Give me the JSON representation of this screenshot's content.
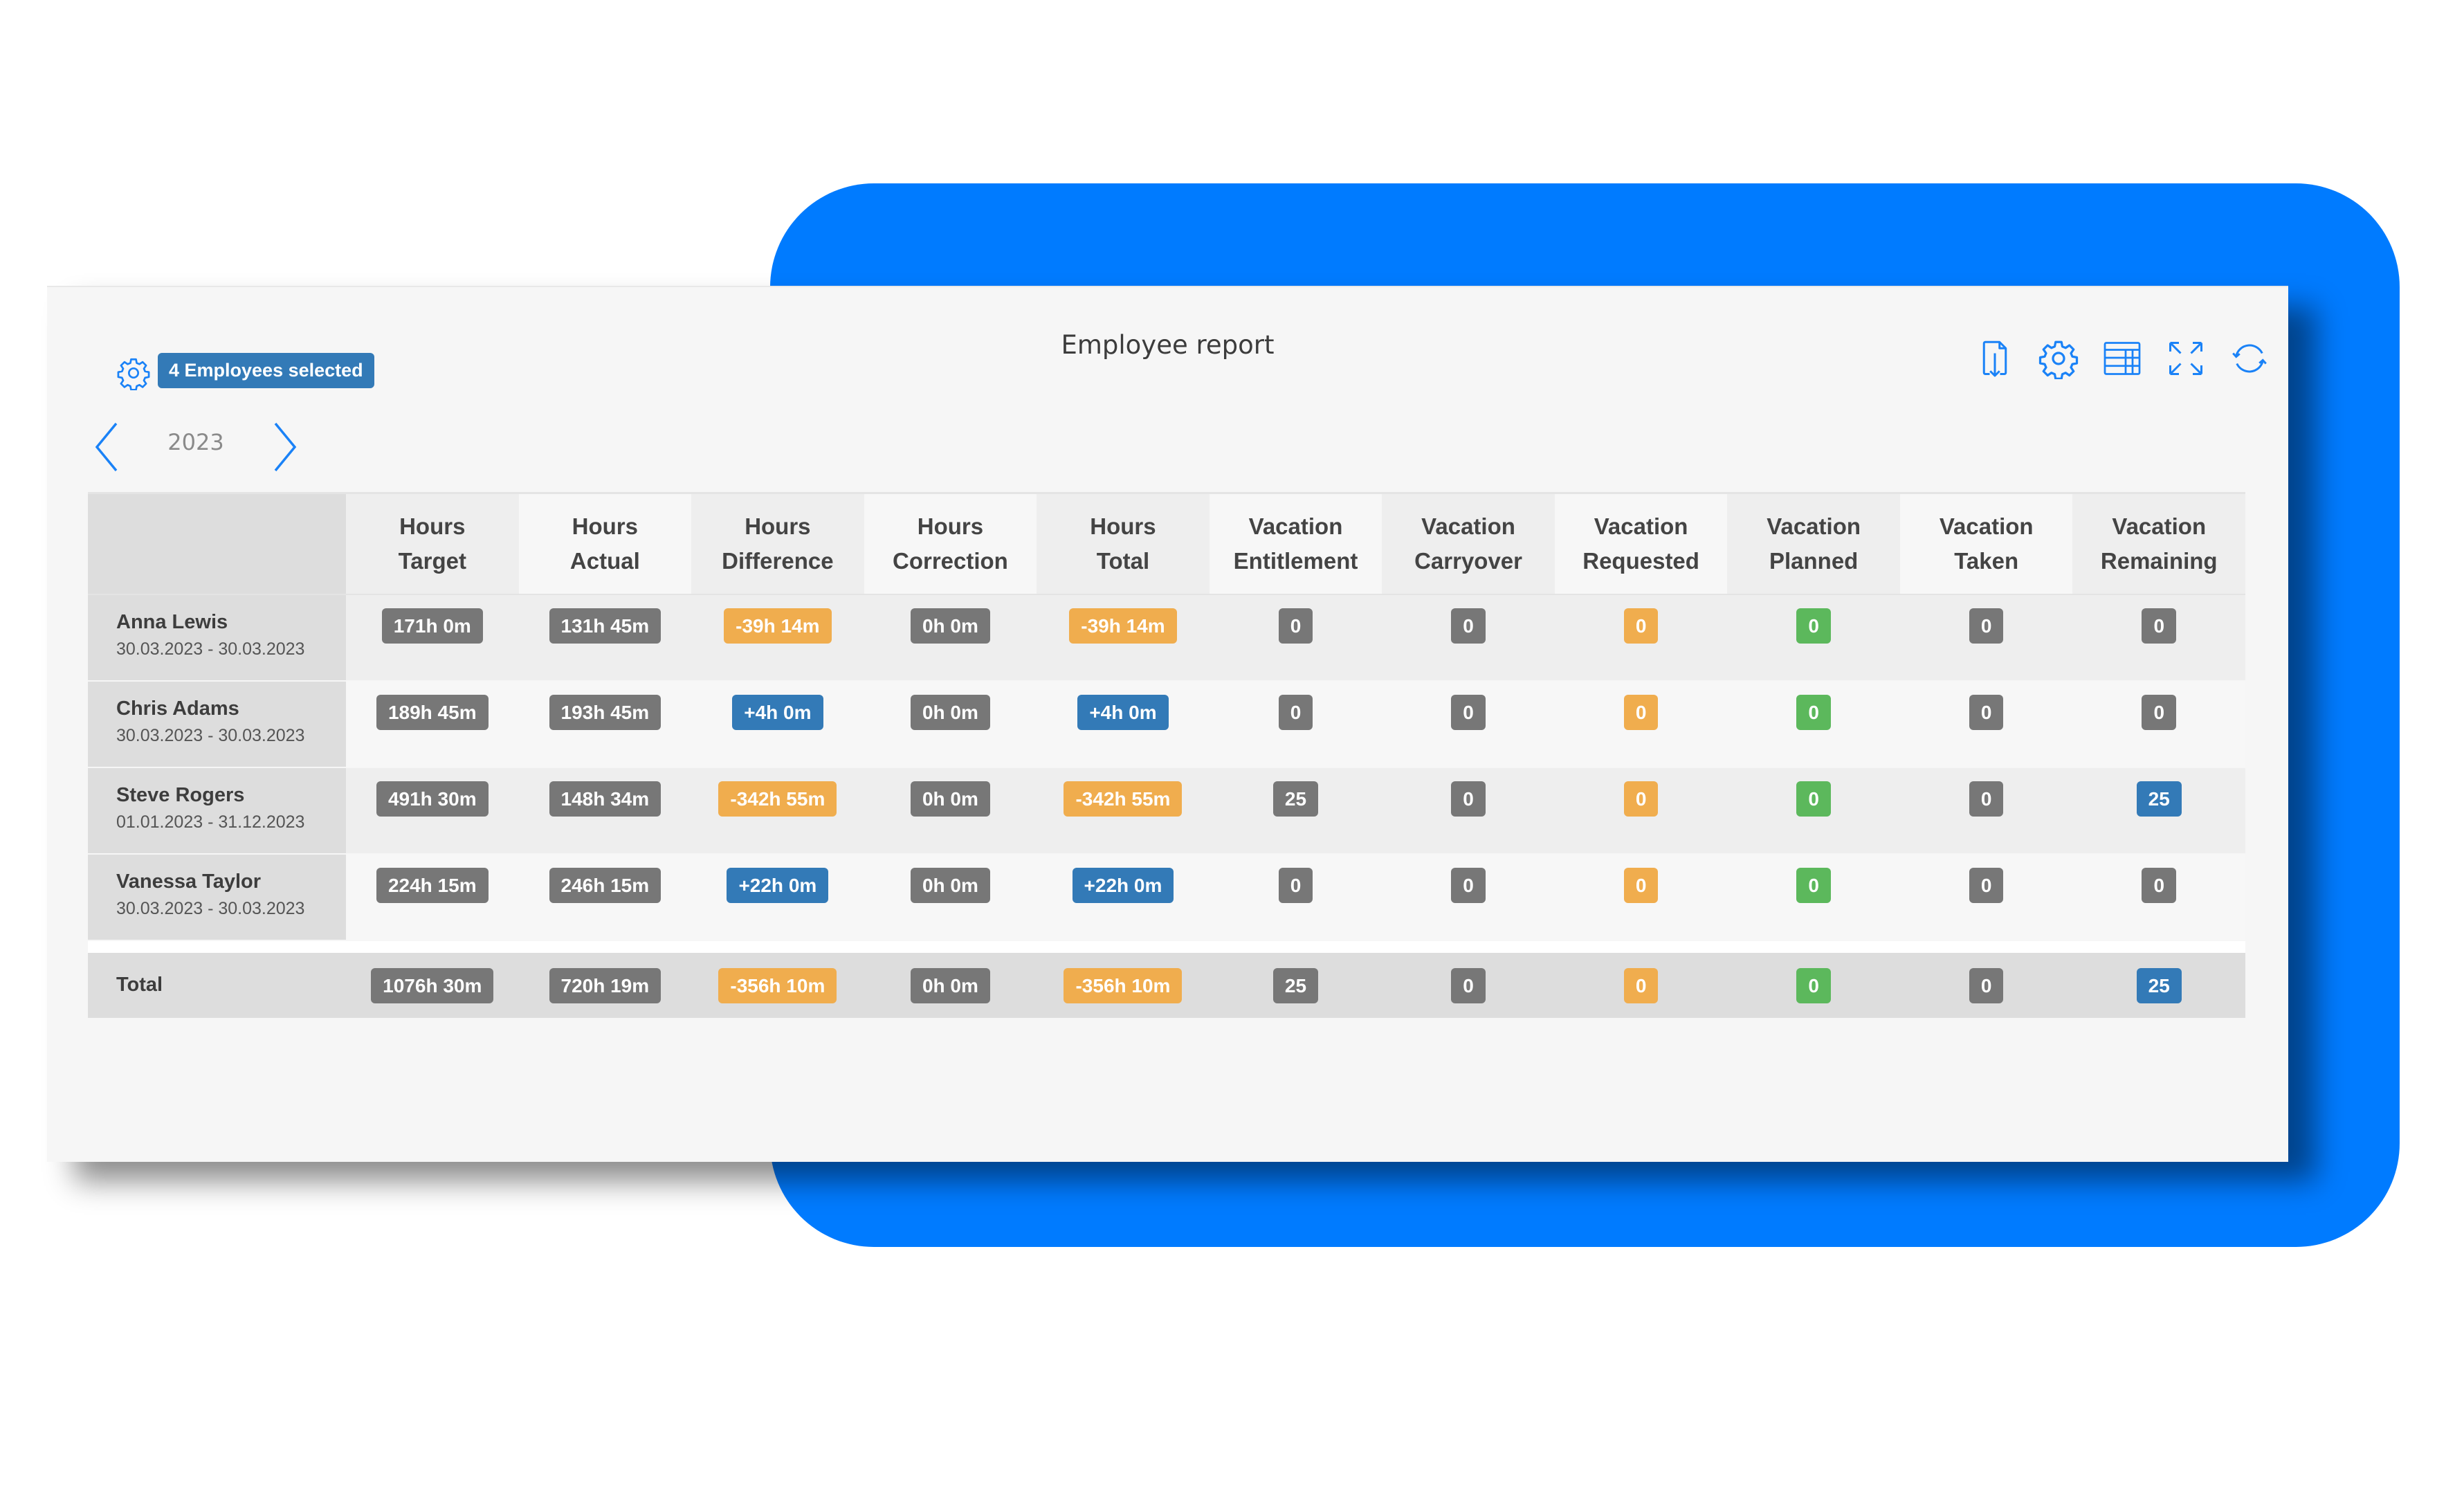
{
  "header": {
    "title": "Employee report",
    "selected_label": "4 Employees selected",
    "year": "2023",
    "toolbar": [
      {
        "name": "export-file-icon",
        "label": "Export"
      },
      {
        "name": "settings-icon",
        "label": "Settings"
      },
      {
        "name": "table-view-icon",
        "label": "Table view"
      },
      {
        "name": "fullscreen-icon",
        "label": "Fullscreen"
      },
      {
        "name": "refresh-icon",
        "label": "Refresh"
      }
    ]
  },
  "colors": {
    "accent": "#007bff",
    "icon": "#1a82f7",
    "badge_gray": "#777777",
    "badge_orange": "#f0ad4e",
    "badge_blue": "#337ab7",
    "badge_green": "#5cb85c"
  },
  "table": {
    "columns": [
      [
        "Hours",
        "Target"
      ],
      [
        "Hours",
        "Actual"
      ],
      [
        "Hours",
        "Difference"
      ],
      [
        "Hours",
        "Correction"
      ],
      [
        "Hours",
        "Total"
      ],
      [
        "Vacation",
        "Entitlement"
      ],
      [
        "Vacation",
        "Carryover"
      ],
      [
        "Vacation",
        "Requested"
      ],
      [
        "Vacation",
        "Planned"
      ],
      [
        "Vacation",
        "Taken"
      ],
      [
        "Vacation",
        "Remaining"
      ]
    ],
    "rows": [
      {
        "name": "Anna Lewis",
        "range": "30.03.2023 - 30.03.2023",
        "cells": [
          {
            "v": "171h 0m",
            "c": "gray"
          },
          {
            "v": "131h 45m",
            "c": "gray"
          },
          {
            "v": "-39h 14m",
            "c": "orange"
          },
          {
            "v": "0h 0m",
            "c": "gray"
          },
          {
            "v": "-39h 14m",
            "c": "orange"
          },
          {
            "v": "0",
            "c": "gray"
          },
          {
            "v": "0",
            "c": "gray"
          },
          {
            "v": "0",
            "c": "orange"
          },
          {
            "v": "0",
            "c": "green"
          },
          {
            "v": "0",
            "c": "gray"
          },
          {
            "v": "0",
            "c": "gray"
          }
        ]
      },
      {
        "name": "Chris Adams",
        "range": "30.03.2023 - 30.03.2023",
        "cells": [
          {
            "v": "189h 45m",
            "c": "gray"
          },
          {
            "v": "193h 45m",
            "c": "gray"
          },
          {
            "v": "+4h 0m",
            "c": "blue"
          },
          {
            "v": "0h 0m",
            "c": "gray"
          },
          {
            "v": "+4h 0m",
            "c": "blue"
          },
          {
            "v": "0",
            "c": "gray"
          },
          {
            "v": "0",
            "c": "gray"
          },
          {
            "v": "0",
            "c": "orange"
          },
          {
            "v": "0",
            "c": "green"
          },
          {
            "v": "0",
            "c": "gray"
          },
          {
            "v": "0",
            "c": "gray"
          }
        ]
      },
      {
        "name": "Steve Rogers",
        "range": "01.01.2023 - 31.12.2023",
        "cells": [
          {
            "v": "491h 30m",
            "c": "gray"
          },
          {
            "v": "148h 34m",
            "c": "gray"
          },
          {
            "v": "-342h 55m",
            "c": "orange"
          },
          {
            "v": "0h 0m",
            "c": "gray"
          },
          {
            "v": "-342h 55m",
            "c": "orange"
          },
          {
            "v": "25",
            "c": "gray"
          },
          {
            "v": "0",
            "c": "gray"
          },
          {
            "v": "0",
            "c": "orange"
          },
          {
            "v": "0",
            "c": "green"
          },
          {
            "v": "0",
            "c": "gray"
          },
          {
            "v": "25",
            "c": "blue"
          }
        ]
      },
      {
        "name": "Vanessa Taylor",
        "range": "30.03.2023 - 30.03.2023",
        "cells": [
          {
            "v": "224h 15m",
            "c": "gray"
          },
          {
            "v": "246h 15m",
            "c": "gray"
          },
          {
            "v": "+22h 0m",
            "c": "blue"
          },
          {
            "v": "0h 0m",
            "c": "gray"
          },
          {
            "v": "+22h 0m",
            "c": "blue"
          },
          {
            "v": "0",
            "c": "gray"
          },
          {
            "v": "0",
            "c": "gray"
          },
          {
            "v": "0",
            "c": "orange"
          },
          {
            "v": "0",
            "c": "green"
          },
          {
            "v": "0",
            "c": "gray"
          },
          {
            "v": "0",
            "c": "gray"
          }
        ]
      }
    ],
    "total": {
      "label": "Total",
      "cells": [
        {
          "v": "1076h 30m",
          "c": "gray"
        },
        {
          "v": "720h 19m",
          "c": "gray"
        },
        {
          "v": "-356h 10m",
          "c": "orange"
        },
        {
          "v": "0h 0m",
          "c": "gray"
        },
        {
          "v": "-356h 10m",
          "c": "orange"
        },
        {
          "v": "25",
          "c": "gray"
        },
        {
          "v": "0",
          "c": "gray"
        },
        {
          "v": "0",
          "c": "orange"
        },
        {
          "v": "0",
          "c": "green"
        },
        {
          "v": "0",
          "c": "gray"
        },
        {
          "v": "25",
          "c": "blue"
        }
      ]
    }
  }
}
